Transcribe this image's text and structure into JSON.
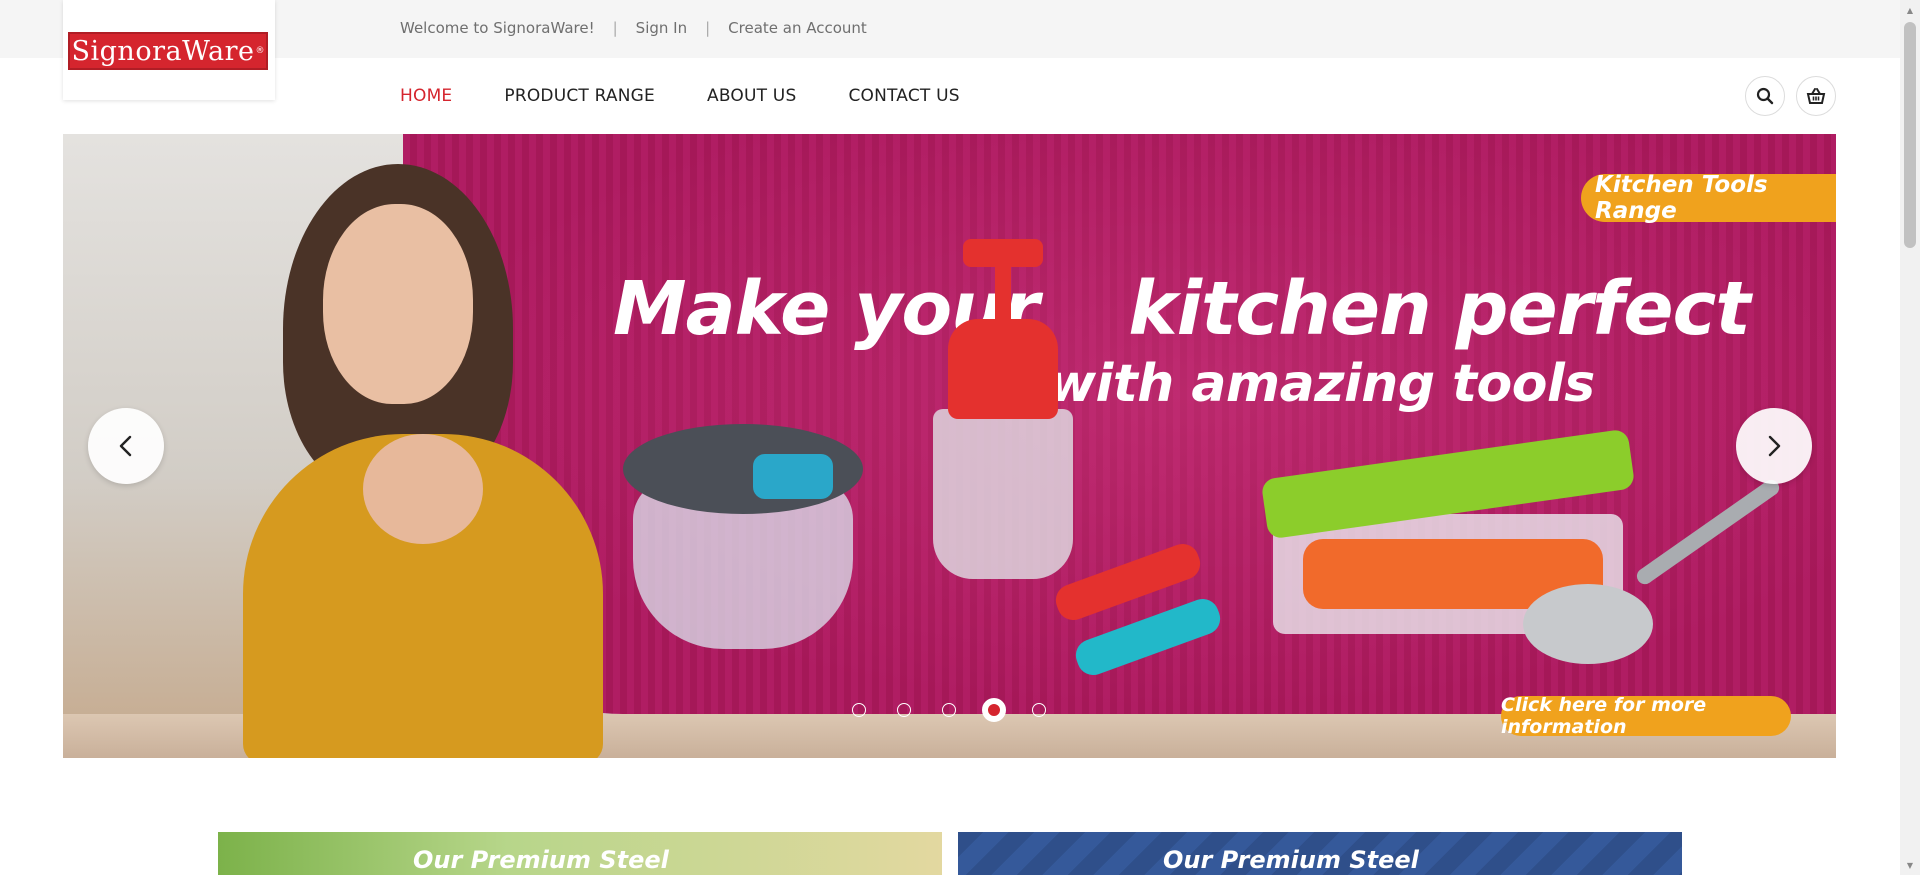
{
  "top_bar": {
    "welcome": "Welcome to SignoraWare!",
    "sign_in": "Sign In",
    "create_account": "Create an Account"
  },
  "logo": {
    "text": "SignoraWare",
    "mark": "®"
  },
  "nav": {
    "items": [
      {
        "label": "HOME",
        "active": true
      },
      {
        "label": "PRODUCT RANGE",
        "active": false
      },
      {
        "label": "ABOUT US",
        "active": false
      },
      {
        "label": "CONTACT US",
        "active": false
      }
    ],
    "icons": [
      "search-icon",
      "basket-icon"
    ]
  },
  "hero": {
    "badge": "Kitchen Tools Range",
    "headline_part1": "Make your",
    "headline_part2": "kitchen perfect",
    "headline_line2": "with amazing tools",
    "cta": "Click here for more information",
    "slides_total": 5,
    "active_slide": 4
  },
  "banners": [
    {
      "text": "Our Premium Steel"
    },
    {
      "text": "Our Premium Steel"
    }
  ],
  "colors": {
    "brand_red": "#d5252e",
    "hero_magenta": "#b01d63",
    "accent_orange": "#f0a21d",
    "topbar_bg": "#f5f5f5"
  }
}
